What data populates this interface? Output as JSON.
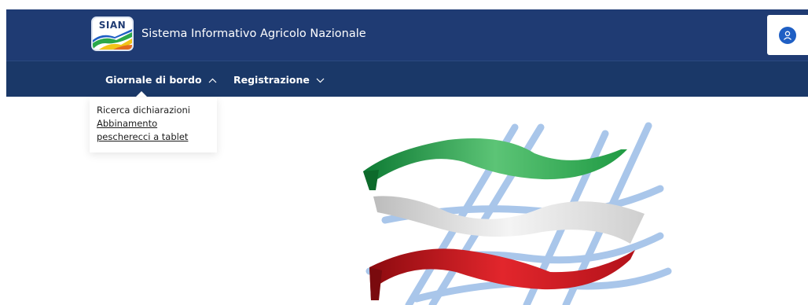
{
  "header": {
    "logo_text": "SIAN",
    "title": "Sistema Informativo Agricolo Nazionale",
    "user_icon": "user-icon",
    "colors": {
      "header_bg": "#1f3b73",
      "nav_bg": "#1a3868",
      "accent": "#1f5fc4"
    }
  },
  "nav": {
    "items": [
      {
        "label": "Giornale di bordo",
        "state": "expanded",
        "icon": "chevron-up-icon"
      },
      {
        "label": "Registrazione",
        "state": "collapsed",
        "icon": "chevron-down-icon"
      }
    ]
  },
  "dropdown": {
    "items": [
      {
        "label": "Ricerca dichiarazioni"
      },
      {
        "label_line1": "Abbinamento",
        "label_line2": "pescherecci a tablet"
      }
    ]
  },
  "emblem": {
    "colors": {
      "green": "#1f9a43",
      "white": "#dedede",
      "red": "#c4141a",
      "net": "#9fbfe6"
    }
  }
}
